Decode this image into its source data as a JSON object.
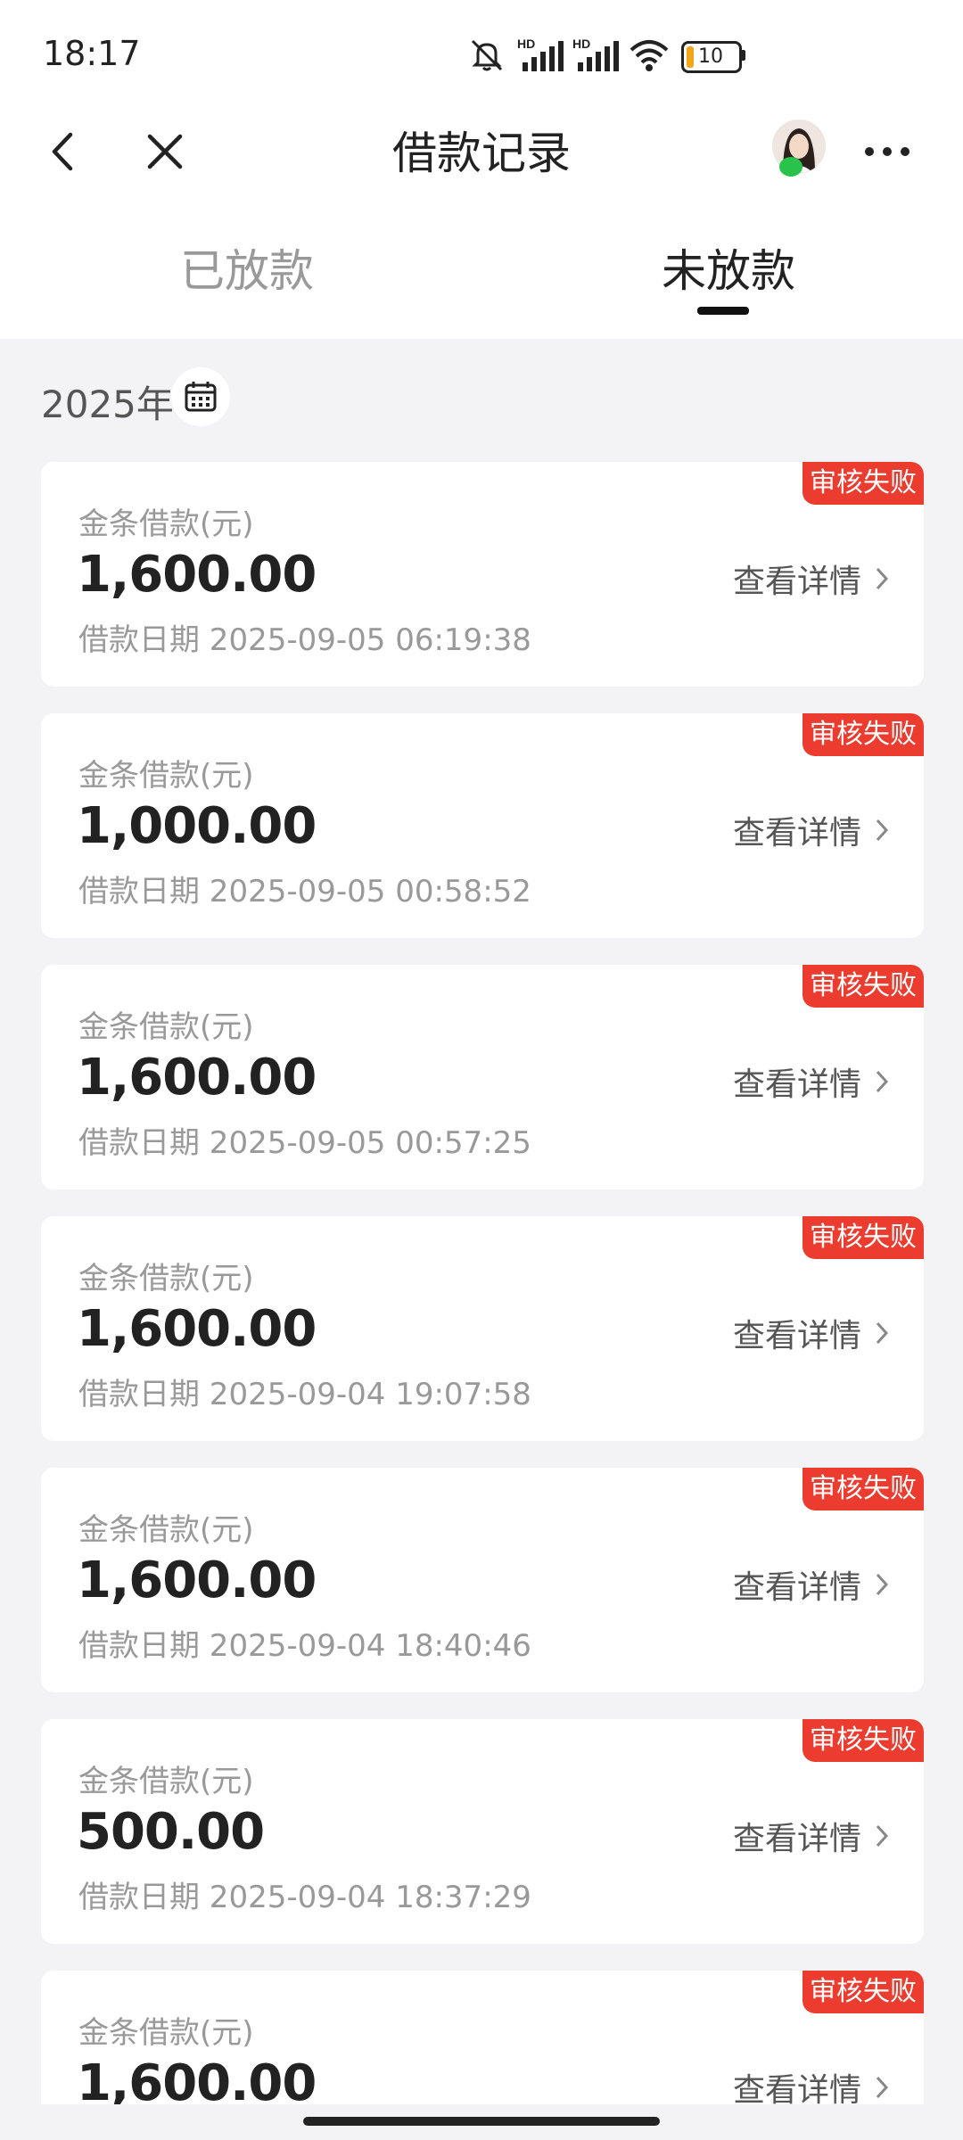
{
  "status_bar": {
    "time": "18:17",
    "battery": "10"
  },
  "header": {
    "title": "借款记录"
  },
  "tabs": [
    {
      "label": "已放款"
    },
    {
      "label": "未放款"
    }
  ],
  "year_label": "2025年",
  "records": [
    {
      "label": "金条借款(元)",
      "amount": "1,600.00",
      "date": "借款日期 2025-09-05 06:19:38",
      "status": "审核失败",
      "detail": "查看详情"
    },
    {
      "label": "金条借款(元)",
      "amount": "1,000.00",
      "date": "借款日期 2025-09-05 00:58:52",
      "status": "审核失败",
      "detail": "查看详情"
    },
    {
      "label": "金条借款(元)",
      "amount": "1,600.00",
      "date": "借款日期 2025-09-05 00:57:25",
      "status": "审核失败",
      "detail": "查看详情"
    },
    {
      "label": "金条借款(元)",
      "amount": "1,600.00",
      "date": "借款日期 2025-09-04 19:07:58",
      "status": "审核失败",
      "detail": "查看详情"
    },
    {
      "label": "金条借款(元)",
      "amount": "1,600.00",
      "date": "借款日期 2025-09-04 18:40:46",
      "status": "审核失败",
      "detail": "查看详情"
    },
    {
      "label": "金条借款(元)",
      "amount": "500.00",
      "date": "借款日期 2025-09-04 18:37:29",
      "status": "审核失败",
      "detail": "查看详情"
    },
    {
      "label": "金条借款(元)",
      "amount": "1,600.00",
      "date": "",
      "status": "审核失败",
      "detail": "查看详情"
    }
  ],
  "colors": {
    "status_badge": "#ec3b2f",
    "page_bg": "#f3f3f6"
  },
  "icons": [
    "back-arrow-icon",
    "close-icon",
    "more-icon",
    "calendar-icon",
    "chevron-right-icon"
  ]
}
